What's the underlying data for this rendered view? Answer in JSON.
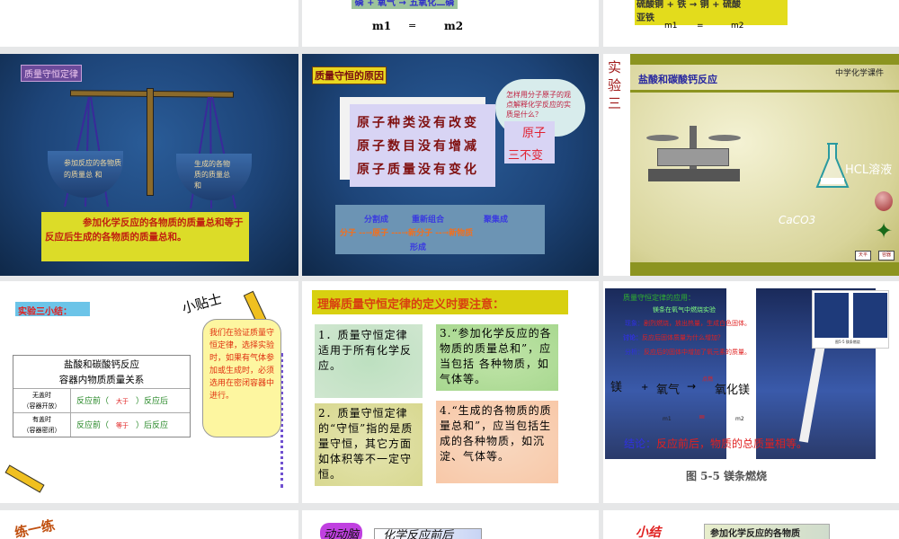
{
  "slides": {
    "s2": {
      "equation": "磷 + 氧气 → 五氧化二磷",
      "m1": "m1",
      "eq": "=",
      "m2": "m2"
    },
    "s3": {
      "equation_line1": "硫酸铜 + 铁 → 铜 + 硫酸",
      "equation_line2": "亚铁",
      "m1": "m1",
      "eq": "=",
      "m2": "m2"
    },
    "s4": {
      "title": "质量守恒定律",
      "left_pan": "参加反应的各物质的质量总 和",
      "right_pan": "生成的各物质的质量总和",
      "statement": "参加化学反应的各物质的质量总和等于反应后生成的各物质的质量总和。"
    },
    "s5": {
      "title": "质量守恒的原因",
      "lines": [
        "原子种类没有改变",
        "原子数目没有增减",
        "原子质量没有变化"
      ],
      "cloud": "怎样用分子原子的观点解释化学反应的实质是什么？",
      "answer1": "原子",
      "answer2": "三不变",
      "flow_top1": "分割成",
      "flow_top2": "重新组合",
      "flow_top3": "聚集成",
      "flow": "分子 --→原子 ---→新分子 --→新物质",
      "flow_bottom": "形成"
    },
    "s6": {
      "side": "实验三",
      "title": "盐酸和碳酸钙反应",
      "brand": "中学化学课件",
      "hcl": "HCL溶液",
      "caco3": "CaCO3",
      "btn1": "天平",
      "btn2": "容器"
    },
    "s7": {
      "title": "实验三小结：",
      "sticker": "小贴士",
      "table_title1": "盐酸和碳酸钙反应",
      "table_title2": "容器内物质质量关系",
      "rows": [
        {
          "cond1": "无盖时",
          "cond2": "（容器开放）",
          "before": "反应前（",
          "rel": "大于",
          "after": "）反应后"
        },
        {
          "cond1": "有盖时",
          "cond2": "（容器密闭）",
          "before": "反应前（",
          "rel": "等于",
          "after": "）后反应"
        }
      ],
      "tip": "我们在验证质量守恒定律，选择实验时，如果有气体参加或生成时，必须选用在密闭容器中进行。"
    },
    "s8": {
      "title": "理解质量守恒定律的定义时要注意：",
      "p1": "1．质量守恒定律适用于所有化学反应。",
      "p2": "2．质量守恒定律的“守恒”指的是质量守恒，其它方面如体积等不一定守恒。",
      "p3": "3.“参加化学反应的各物质的质量总和”，应当包括 各种物质，如气体等。",
      "p4": "4.“生成的各物质的质量总和”，应当包括生成的各种物质，如沉淀、气体等。"
    },
    "s9": {
      "title": "质量守恒定律的应用：",
      "sub": "镁条在氧气中燃烧实验",
      "l1_label": "现象：",
      "l1": "剧烈燃烧，放出热量，生成白色固体。",
      "l2_label": "讨论：",
      "l2": "反应后固体质量为什么增加？",
      "l3_label": "分析：",
      "l3": "反应后的固体中增加了氧元素的质量。",
      "cond": "点燃",
      "eq_a": "镁",
      "eq_plus": "+",
      "eq_b": "氧气",
      "eq_arrow": "→",
      "eq_c": "氧化镁",
      "m1": "m1",
      "eq": "=",
      "m2": "m2",
      "conclusion_label": "结论：",
      "conclusion": "反应前后，物质的总质量相等。",
      "caption": "图 5-5  镁条燃烧",
      "inset_caption": "图5-5 镁条燃烧"
    },
    "s10": {
      "title": "练一练"
    },
    "s11": {
      "badge": "动动脑",
      "text": "化学反应前后"
    },
    "s12": {
      "title": "小结",
      "text": "参加化学反应的各物质"
    }
  }
}
